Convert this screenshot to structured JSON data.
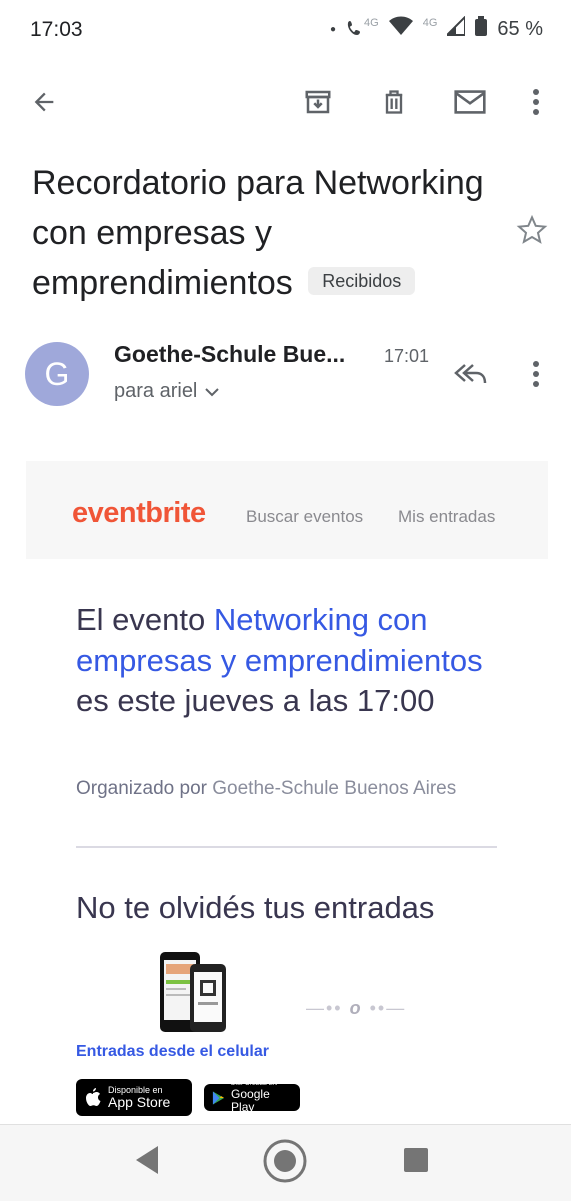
{
  "status_bar": {
    "time": "17:03",
    "network_small_1": "4G",
    "network_small_2": "4G",
    "battery": "65 %"
  },
  "toolbar": {
    "back": "arrow-back-icon",
    "archive": "archive-icon",
    "delete": "trash-icon",
    "mark_unread": "mail-icon",
    "more": "more-vert-icon"
  },
  "email": {
    "subject": "Recordatorio para Networking con empresas y emprendimientos",
    "label": "Recibidos",
    "sender_initial": "G",
    "sender_name": "Goethe-Schule Bue...",
    "time": "17:01",
    "recipient": "para ariel"
  },
  "body": {
    "brand": "eventbrite",
    "nav_search": "Buscar eventos",
    "nav_tickets": "Mis entradas",
    "event_prefix": "El evento ",
    "event_name": "Networking con empresas y emprendimientos",
    "event_suffix": " es este jueves a las 17:00",
    "organized_by": "Organizado por ",
    "organizer": "Goethe-Schule Buenos Aires",
    "reminder": "No te olvidés tus entradas",
    "mobile_link": "Entradas desde el celular",
    "app_store_small": "Disponible en",
    "app_store_big": "App Store",
    "google_play_small": "DISPONIBLE EN",
    "google_play_big": "Google Play"
  },
  "colors": {
    "eventbrite_orange": "#f05537",
    "link_blue": "#3659e3",
    "avatar": "#9fa8da"
  }
}
